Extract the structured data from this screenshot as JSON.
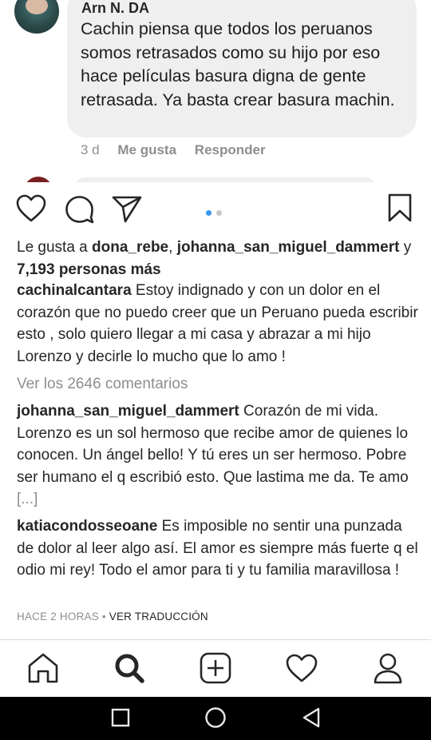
{
  "embedded_comment": {
    "author": "Arn N. DA",
    "text": "Cachin piensa que todos los peruanos somos retrasados como su hijo por eso hace películas basura digna de gente retrasada. Ya basta crear basura machin.",
    "time": "3 d",
    "like_label": "Me gusta",
    "reply_label": "Responder"
  },
  "carousel": {
    "total": 2,
    "active": 1
  },
  "likes": {
    "prefix": "Le gusta a ",
    "user1": "dona_rebe",
    "sep": ", ",
    "user2": "johanna_san_miguel_dammert",
    "conj": " y ",
    "others": "7,193 personas más"
  },
  "caption": {
    "username": "cachinalcantara",
    "text": " Estoy indignado y con un dolor en el corazón que no puedo creer que un Peruano pueda escribir esto , solo quiero llegar a mi casa y abrazar a mi hijo Lorenzo y decirle lo mucho que lo amo !"
  },
  "view_all_comments": "Ver los 2646 comentarios",
  "comments": [
    {
      "username": "johanna_san_miguel_dammert",
      "text": " Corazón de mi vida. Lorenzo es un sol hermoso que recibe amor de quienes lo conocen. Un ángel bello! Y tú eres un ser hermoso. Pobre ser humano el q escribió esto. Que lastima me da. Te amo ",
      "more": "[...]"
    },
    {
      "username": "katiacondosseoane",
      "text": " Es imposible no sentir una punzada de dolor al leer algo así. El amor es siempre más fuerte q el odio mi rey! Todo el amor para ti y tu familia maravillosa !"
    }
  ],
  "timestamp": "HACE 2 HORAS",
  "timestamp_sep": " • ",
  "translate_label": "VER TRADUCCIÓN",
  "bottom_nav": [
    "home-icon",
    "search-icon",
    "new-post-icon",
    "activity-icon",
    "profile-icon"
  ],
  "system_nav": [
    "recents-icon",
    "home-circle-icon",
    "back-icon"
  ],
  "colors": {
    "accent": "#3897f0",
    "text": "#262626",
    "muted": "#8e8e8e",
    "bubble": "#efefef"
  }
}
